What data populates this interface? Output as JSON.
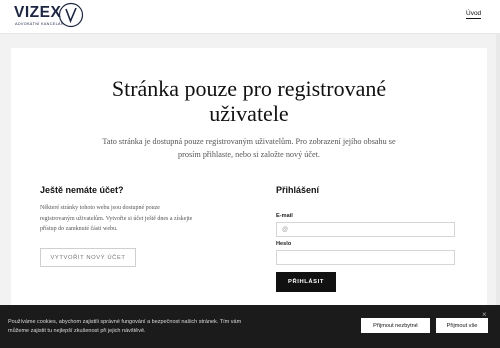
{
  "header": {
    "logo_text": "VIZEX",
    "logo_subtext": "ADVOKÁTNÍ KANCELÁŘ",
    "nav_uvod": "Úvod"
  },
  "main": {
    "title_line1": "Stránka pouze pro registrované",
    "title_line2": "uživatele",
    "intro_line1": "Tato stránka je dostupná pouze registrovaným uživatelům. Pro zobrazení jejího obsahu se",
    "intro_line2": "prosím přihlaste, nebo si založte nový účet."
  },
  "register": {
    "heading": "Ještě nemáte účet?",
    "text_line1": "Některé stránky tohoto webu jsou dostupné pouze",
    "text_line2": "registrovaným uživatelům. Vytvořte si účet ještě dnes a získejte",
    "text_line3": "přístup do zamknuté části webu.",
    "button": "VYTVOŘIT NOVÝ ÚČET"
  },
  "login": {
    "heading": "Přihlášení",
    "email_label": "E-mail",
    "email_placeholder": "@",
    "password_label": "Heslo",
    "password_value": "",
    "button": "PŘIHLÁSIT"
  },
  "cookie": {
    "text_line1": "Používáme cookies, abychom zajistili správné fungování a bezpečnost našich stránek. Tím vám",
    "text_line2": "můžeme zajistit tu nejlepší zkušenost při jejich návštěvě.",
    "necessary_button": "Přijmout nezbytné",
    "all_button": "Přijmout vše",
    "close": "×"
  }
}
